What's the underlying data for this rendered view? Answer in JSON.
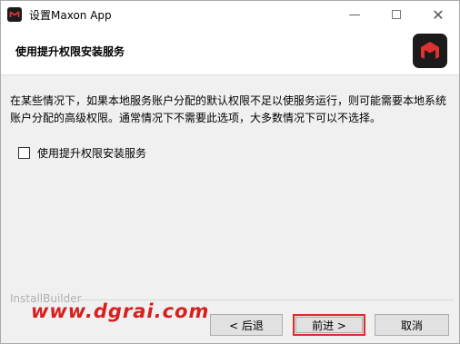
{
  "window": {
    "title": "设置Maxon App",
    "min_glyph": "—",
    "close_glyph": "✕",
    "brand_color": "#1b1b1b",
    "accent_color": "#e03030"
  },
  "header": {
    "title": "使用提升权限安装服务"
  },
  "content": {
    "description": "在某些情况下，如果本地服务账户分配的默认权限不足以使服务运行，则可能需要本地系统账户分配的高级权限。通常情况下不需要此选项，大多数情况下可以不选择。",
    "checkbox_label": "使用提升权限安装服务",
    "checkbox_checked": false
  },
  "footer": {
    "installbuilder_label": "InstallBuilder",
    "watermark": "www.dgrai.com",
    "back_label": "< 后退",
    "next_label": "前进 >",
    "cancel_label": "取消"
  }
}
